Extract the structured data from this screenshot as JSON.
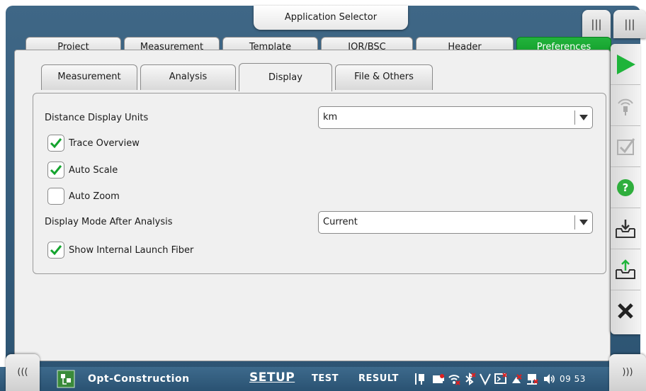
{
  "app_selector": {
    "label": "Application Selector"
  },
  "corner": {
    "left_glyph": "|||",
    "right_glyph": "|||"
  },
  "main_tabs": [
    {
      "label": "Project"
    },
    {
      "label": "Measurement"
    },
    {
      "label": "Template"
    },
    {
      "label": "IOR/BSC"
    },
    {
      "label": "Header"
    },
    {
      "label": "Preferences"
    }
  ],
  "sub_tabs": [
    {
      "label": "Measurement"
    },
    {
      "label": "Analysis"
    },
    {
      "label": "Display"
    },
    {
      "label": "File & Others"
    }
  ],
  "settings": {
    "distance_units": {
      "label": "Distance Display Units",
      "value": "km"
    },
    "trace_overview": {
      "label": "Trace Overview",
      "checked": true
    },
    "auto_scale": {
      "label": "Auto Scale",
      "checked": true
    },
    "auto_zoom": {
      "label": "Auto Zoom",
      "checked": false
    },
    "display_mode": {
      "label": "Display Mode After Analysis",
      "value": "Current"
    },
    "show_launch_fiber": {
      "label": "Show Internal Launch Fiber",
      "checked": true
    }
  },
  "side_buttons": [
    {
      "icon": "play-icon"
    },
    {
      "icon": "probe-icon"
    },
    {
      "icon": "checklist-icon"
    },
    {
      "icon": "help-icon"
    },
    {
      "icon": "save-icon"
    },
    {
      "icon": "load-icon"
    },
    {
      "icon": "close-icon"
    }
  ],
  "statusbar": {
    "left_nav": "(((",
    "right_nav": ")))",
    "app_name": "Opt-Construction",
    "setup": "SETUP",
    "test": "TEST",
    "result": "RESULT",
    "time": "09 53"
  },
  "colors": {
    "accent_green": "#14a42e",
    "status_blue": "#2f5a7a"
  }
}
